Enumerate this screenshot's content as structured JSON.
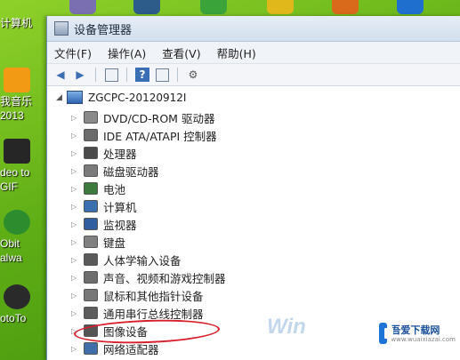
{
  "desktop": {
    "icons": [
      {
        "label": "计算机",
        "color": "#cfd8e6"
      },
      {
        "label": "我音乐\n2013",
        "color": "#f29a14"
      },
      {
        "label": "deo to\nGIF",
        "color": "#262626"
      },
      {
        "label": "Obit\nalwa",
        "color": "#2d8c2d"
      },
      {
        "label": "otoTo",
        "color": "#2a2a2a"
      }
    ]
  },
  "window": {
    "title": "设备管理器",
    "menu": [
      "文件(F)",
      "操作(A)",
      "查看(V)",
      "帮助(H)"
    ],
    "toolbar_icons": [
      "back-arrow-icon",
      "forward-arrow-icon",
      "properties-icon",
      "help-icon",
      "view-icon",
      "device-icon"
    ],
    "tree": {
      "root": "ZGCPC-20120912I",
      "nodes": [
        {
          "label": "DVD/CD-ROM 驱动器",
          "icon": "dvd-drive-icon",
          "color": "#8a8a8a"
        },
        {
          "label": "IDE ATA/ATAPI 控制器",
          "icon": "ide-controller-icon",
          "color": "#6b6b6b"
        },
        {
          "label": "处理器",
          "icon": "processor-icon",
          "color": "#4a4a4a"
        },
        {
          "label": "磁盘驱动器",
          "icon": "disk-drive-icon",
          "color": "#7a7a7a"
        },
        {
          "label": "电池",
          "icon": "battery-icon",
          "color": "#3d7a3d"
        },
        {
          "label": "计算机",
          "icon": "computer-icon",
          "color": "#3a6fb0"
        },
        {
          "label": "监视器",
          "icon": "monitor-icon",
          "color": "#2f5f9e"
        },
        {
          "label": "键盘",
          "icon": "keyboard-icon",
          "color": "#808080"
        },
        {
          "label": "人体学输入设备",
          "icon": "hid-icon",
          "color": "#5a5a5a"
        },
        {
          "label": "声音、视频和游戏控制器",
          "icon": "sound-icon",
          "color": "#6d6d6d"
        },
        {
          "label": "鼠标和其他指针设备",
          "icon": "mouse-icon",
          "color": "#777777"
        },
        {
          "label": "通用串行总线控制器",
          "icon": "usb-controller-icon",
          "color": "#5c5c5c"
        },
        {
          "label": "图像设备",
          "icon": "camera-icon",
          "color": "#555555"
        },
        {
          "label": "网络适配器",
          "icon": "network-adapter-icon",
          "color": "#3f6ea8"
        }
      ]
    }
  },
  "watermark": {
    "text": "Win",
    "site": "吾爱下载网",
    "url": "www.wuaixiazai.com"
  }
}
